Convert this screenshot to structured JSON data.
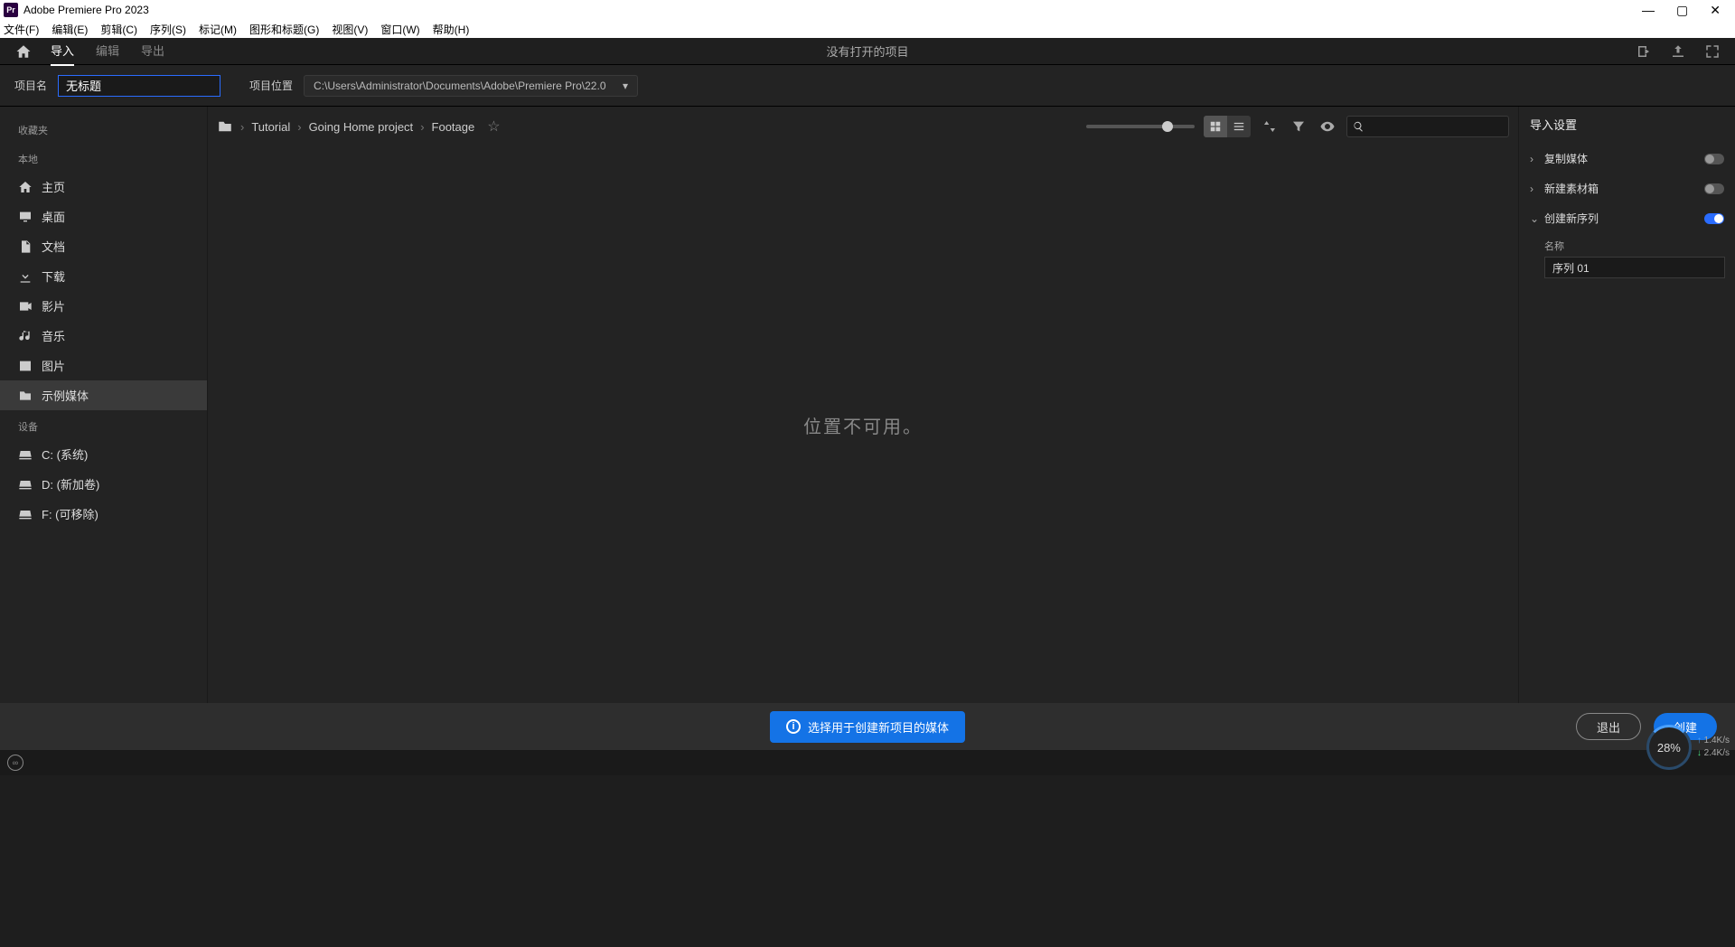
{
  "titlebar": {
    "app": "Adobe Premiere Pro 2023",
    "icon_text": "Pr"
  },
  "menubar": [
    "文件(F)",
    "编辑(E)",
    "剪辑(C)",
    "序列(S)",
    "标记(M)",
    "图形和标题(G)",
    "视图(V)",
    "窗口(W)",
    "帮助(H)"
  ],
  "toolbar": {
    "tabs": [
      "导入",
      "编辑",
      "导出"
    ],
    "active_tab": 0,
    "center_title": "没有打开的项目"
  },
  "project": {
    "name_label": "项目名",
    "name_value": "无标题",
    "location_label": "项目位置",
    "location_value": "C:\\Users\\Administrator\\Documents\\Adobe\\Premiere Pro\\22.0"
  },
  "sidebar": {
    "favorites_label": "收藏夹",
    "local_label": "本地",
    "local_items": [
      {
        "icon": "home",
        "label": "主页"
      },
      {
        "icon": "desktop",
        "label": "桌面"
      },
      {
        "icon": "document",
        "label": "文档"
      },
      {
        "icon": "download",
        "label": "下载"
      },
      {
        "icon": "video",
        "label": "影片"
      },
      {
        "icon": "music",
        "label": "音乐"
      },
      {
        "icon": "image",
        "label": "图片"
      },
      {
        "icon": "folder",
        "label": "示例媒体",
        "active": true
      }
    ],
    "devices_label": "设备",
    "device_items": [
      {
        "icon": "drive",
        "label": "C: (系统)"
      },
      {
        "icon": "drive",
        "label": "D: (新加卷)"
      },
      {
        "icon": "drive",
        "label": "F: (可移除)"
      }
    ]
  },
  "breadcrumb": [
    "Tutorial",
    "Going Home project",
    "Footage"
  ],
  "browser_message": "位置不可用。",
  "search_placeholder": "",
  "right_panel": {
    "title": "导入设置",
    "settings": [
      {
        "label": "复制媒体",
        "on": false,
        "expanded": false
      },
      {
        "label": "新建素材箱",
        "on": false,
        "expanded": false
      },
      {
        "label": "创建新序列",
        "on": true,
        "expanded": true
      }
    ],
    "sequence_name_label": "名称",
    "sequence_name_value": "序列 01"
  },
  "bottom": {
    "info_text": "选择用于创建新项目的媒体",
    "exit_label": "退出",
    "create_label": "创建"
  },
  "network": {
    "percent": "28%",
    "up": "1.4K/s",
    "down": "2.4K/s"
  }
}
